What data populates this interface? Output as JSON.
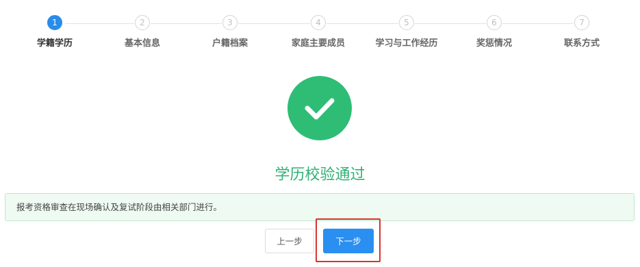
{
  "steps": [
    {
      "number": "1",
      "label": "学籍学历",
      "active": true
    },
    {
      "number": "2",
      "label": "基本信息",
      "active": false
    },
    {
      "number": "3",
      "label": "户籍档案",
      "active": false
    },
    {
      "number": "4",
      "label": "家庭主要成员",
      "active": false
    },
    {
      "number": "5",
      "label": "学习与工作经历",
      "active": false
    },
    {
      "number": "6",
      "label": "奖惩情况",
      "active": false
    },
    {
      "number": "7",
      "label": "联系方式",
      "active": false
    }
  ],
  "result": {
    "icon": "check-icon",
    "title": "学历校验通过"
  },
  "notice": {
    "text": "报考资格审查在现场确认及复试阶段由相关部门进行。"
  },
  "buttons": {
    "prev_label": "上一步",
    "next_label": "下一步"
  },
  "colors": {
    "accent": "#2a8cea",
    "success": "#2fbd76",
    "highlight": "#d8332b"
  }
}
